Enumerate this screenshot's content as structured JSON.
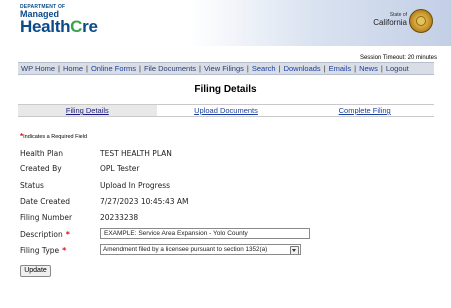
{
  "header": {
    "dept_line": "DEPARTMENT OF",
    "managed": "Managed",
    "health": "Health",
    "care_accent": "C",
    "care_rest": "re",
    "state_of": "State of",
    "california": "California",
    "seal_icon": "california-state-seal"
  },
  "session_timeout": "Session Timeout: 20 minutes",
  "nav": {
    "items": [
      "WP Home",
      "Home",
      "Online Forms",
      "File Documents",
      "View Filings",
      "Search",
      "Downloads",
      "Emails",
      "News",
      "Logout"
    ],
    "separator": "|"
  },
  "page_title": "Filing Details",
  "tabs": [
    "Filing Details",
    "Upload Documents",
    "Complete Filing"
  ],
  "required_note": "Indicates a Required Field",
  "form": {
    "health_plan": {
      "label": "Health Plan",
      "value": "TEST HEALTH PLAN"
    },
    "created_by": {
      "label": "Created By",
      "value": "OPL Tester"
    },
    "status": {
      "label": "Status",
      "value": "Upload In Progress"
    },
    "date_created": {
      "label": "Date Created",
      "value": "7/27/2023 10:45:43 AM"
    },
    "filing_number": {
      "label": "Filing Number",
      "value": "20233238"
    },
    "description": {
      "label": "Description",
      "value": "EXAMPLE: Service Area Expansion - Yolo County"
    },
    "filing_type": {
      "label": "Filing Type",
      "value": "Amendment filed by a licensee pursuant to section 1352(a)"
    }
  },
  "update_button": "Update",
  "colors": {
    "required_star": "#dd1111",
    "brand_blue": "#0b4a8b",
    "brand_green": "#3aa44a",
    "link": "#1a3ea0"
  }
}
